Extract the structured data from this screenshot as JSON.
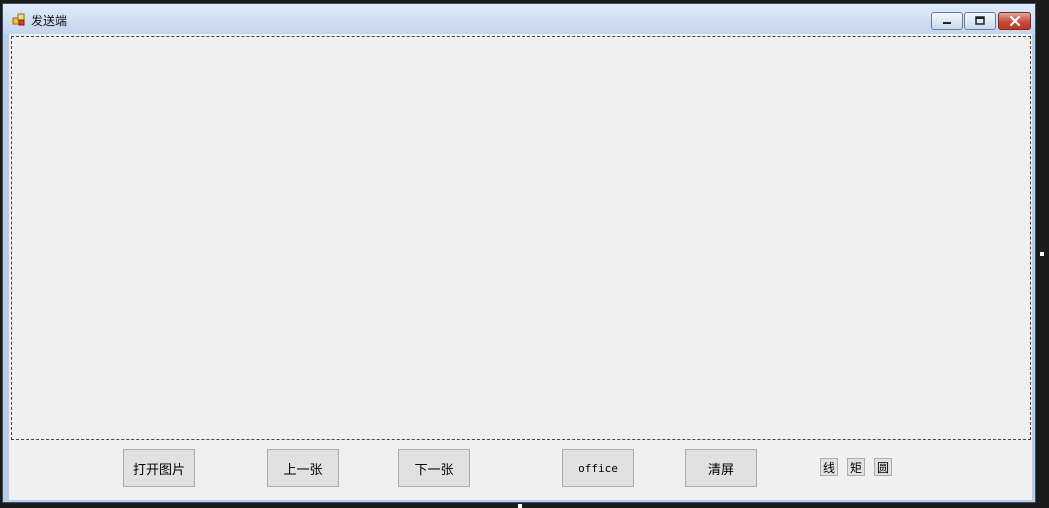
{
  "window": {
    "title": "发送端"
  },
  "toolbar": {
    "open_image": "打开图片",
    "previous": "上一张",
    "next": "下一张",
    "office": "office",
    "clear": "清屏",
    "line": "线",
    "rectangle": "矩",
    "circle": "圆"
  }
}
